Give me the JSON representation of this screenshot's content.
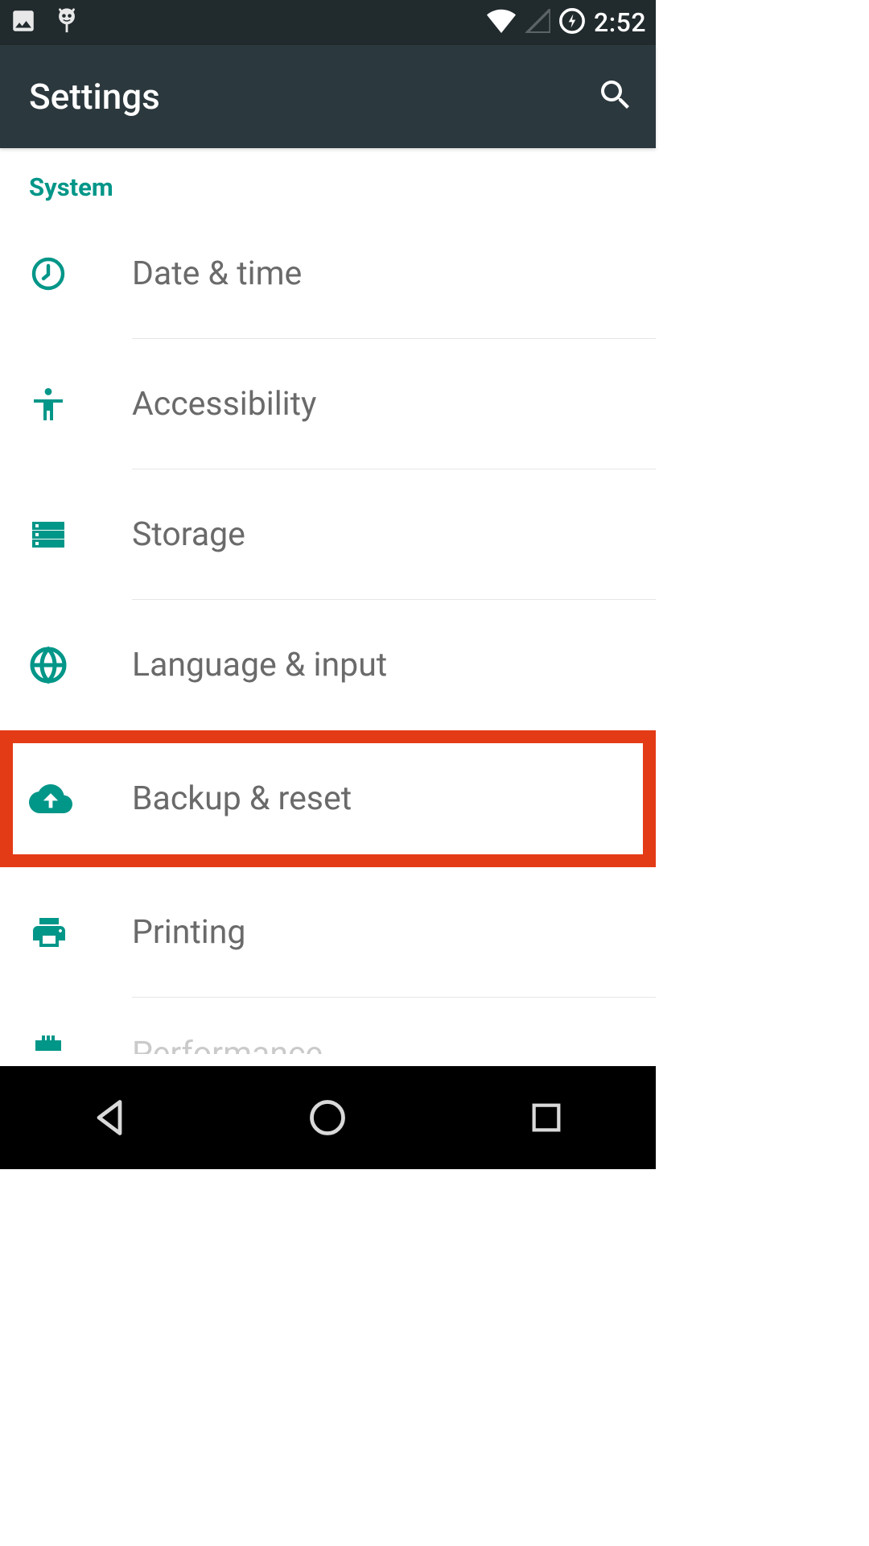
{
  "status_bar": {
    "time": "2:52"
  },
  "app_bar": {
    "title": "Settings"
  },
  "section": {
    "title": "System"
  },
  "rows": {
    "date_time": "Date & time",
    "accessibility": "Accessibility",
    "storage": "Storage",
    "language_input": "Language & input",
    "backup_reset": "Backup & reset",
    "printing": "Printing",
    "performance": "Performance"
  }
}
